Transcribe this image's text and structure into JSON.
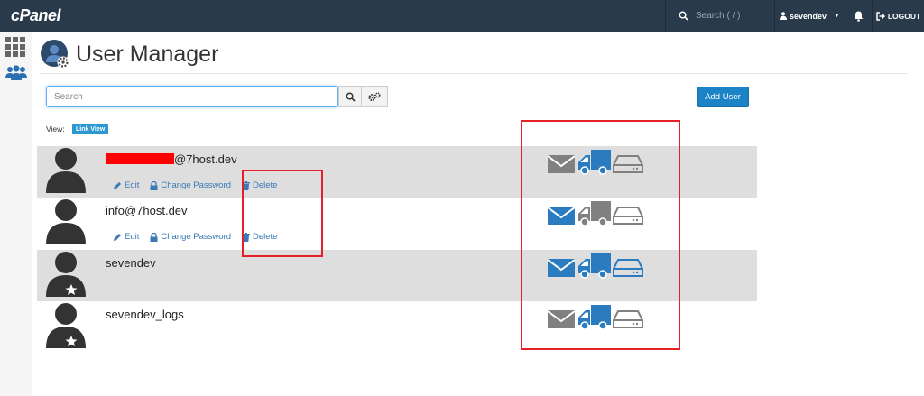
{
  "topbar": {
    "logo": "cPanel",
    "search_placeholder": "Search ( / )",
    "username": "sevendev",
    "logout": "LOGOUT"
  },
  "page": {
    "title": "User Manager",
    "search_placeholder": "Search",
    "add_user": "Add User",
    "view_label": "View:",
    "view_mode": "Link View"
  },
  "actions": {
    "edit": "Edit",
    "change_password": "Change Password",
    "delete": "Delete"
  },
  "users": [
    {
      "name_suffix": "@7host.dev",
      "redacted": true,
      "shaded": true,
      "has_actions": true,
      "star": false,
      "email": "gray",
      "ftp": "blue",
      "disk": "gray"
    },
    {
      "name_suffix": "info@7host.dev",
      "redacted": false,
      "shaded": false,
      "has_actions": true,
      "star": false,
      "email": "blue",
      "ftp": "gray",
      "disk": "gray"
    },
    {
      "name_suffix": "sevendev",
      "redacted": false,
      "shaded": true,
      "has_actions": false,
      "star": true,
      "email": "blue",
      "ftp": "blue",
      "disk": "blue"
    },
    {
      "name_suffix": "sevendev_logs",
      "redacted": false,
      "shaded": false,
      "has_actions": false,
      "star": true,
      "email": "gray",
      "ftp": "blue",
      "disk": "gray"
    }
  ],
  "colors": {
    "topbar": "#293a4a",
    "service_on": "#2b7bc0",
    "service_off": "#808080",
    "row_shade": "#dedede",
    "highlight": "#e5202a"
  }
}
